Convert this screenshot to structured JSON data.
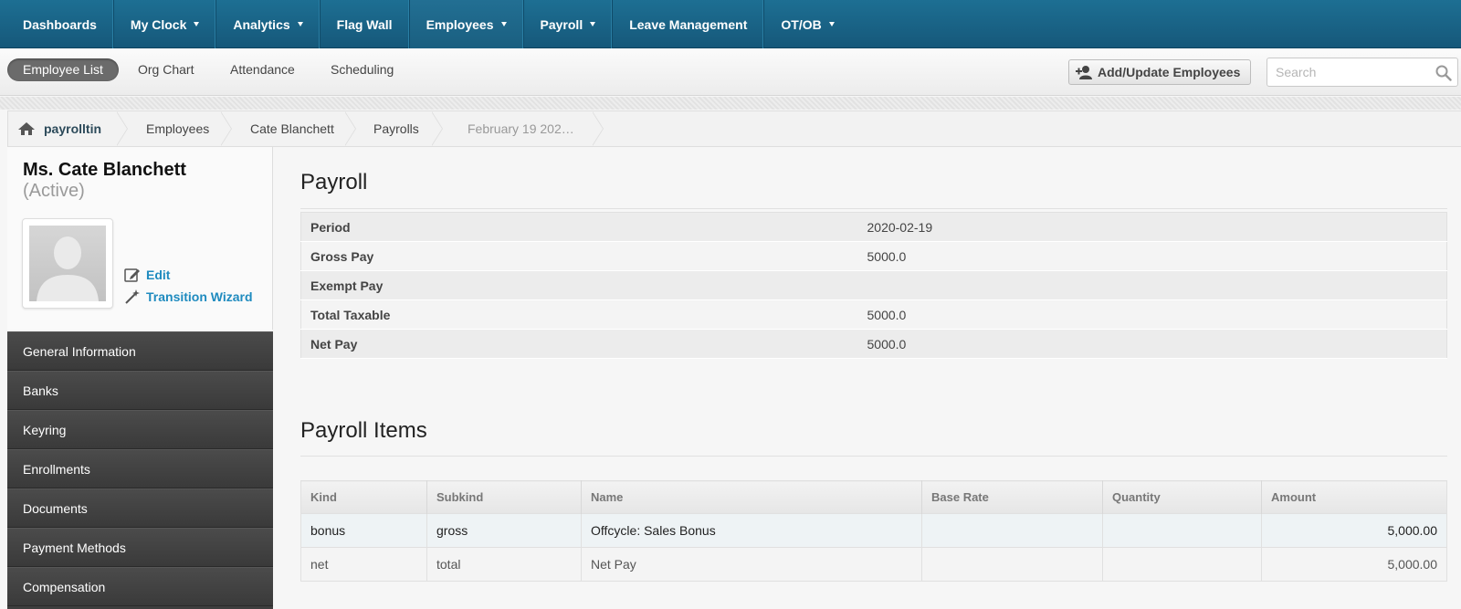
{
  "topnav": {
    "items": [
      {
        "label": "Dashboards",
        "caret": false
      },
      {
        "label": "My Clock",
        "caret": true
      },
      {
        "label": "Analytics",
        "caret": true
      },
      {
        "label": "Flag Wall",
        "caret": false
      },
      {
        "label": "Employees",
        "caret": true
      },
      {
        "label": "Payroll",
        "caret": true
      },
      {
        "label": "Leave Management",
        "caret": false
      },
      {
        "label": "OT/OB",
        "caret": true
      }
    ]
  },
  "subnav": {
    "tabs": [
      "Employee List",
      "Org Chart",
      "Attendance",
      "Scheduling"
    ],
    "add_button": "Add/Update Employees",
    "search_placeholder": "Search"
  },
  "breadcrumb": {
    "home": "payrolltin",
    "items": [
      "Employees",
      "Cate Blanchett",
      "Payrolls"
    ],
    "current": "February 19 202…"
  },
  "profile": {
    "name": "Ms. Cate Blanchett",
    "status": "(Active)",
    "edit_label": "Edit",
    "wizard_label": "Transition Wizard"
  },
  "sidemenu": {
    "items": [
      "General Information",
      "Banks",
      "Keyring",
      "Enrollments",
      "Documents",
      "Payment Methods",
      "Compensation"
    ]
  },
  "payroll": {
    "title": "Payroll",
    "rows": [
      {
        "key": "Period",
        "value": "2020-02-19"
      },
      {
        "key": "Gross Pay",
        "value": "5000.0"
      },
      {
        "key": "Exempt Pay",
        "value": ""
      },
      {
        "key": "Total Taxable",
        "value": "5000.0"
      },
      {
        "key": "Net Pay",
        "value": "5000.0"
      }
    ]
  },
  "payroll_items": {
    "title": "Payroll Items",
    "columns": [
      "Kind",
      "Subkind",
      "Name",
      "Base Rate",
      "Quantity",
      "Amount"
    ],
    "rows": [
      {
        "kind": "bonus",
        "subkind": "gross",
        "name": "Offcycle: Sales Bonus",
        "base_rate": "",
        "quantity": "",
        "amount": "5,000.00"
      },
      {
        "kind": "net",
        "subkind": "total",
        "name": "Net Pay",
        "base_rate": "",
        "quantity": "",
        "amount": "5,000.00"
      }
    ]
  }
}
